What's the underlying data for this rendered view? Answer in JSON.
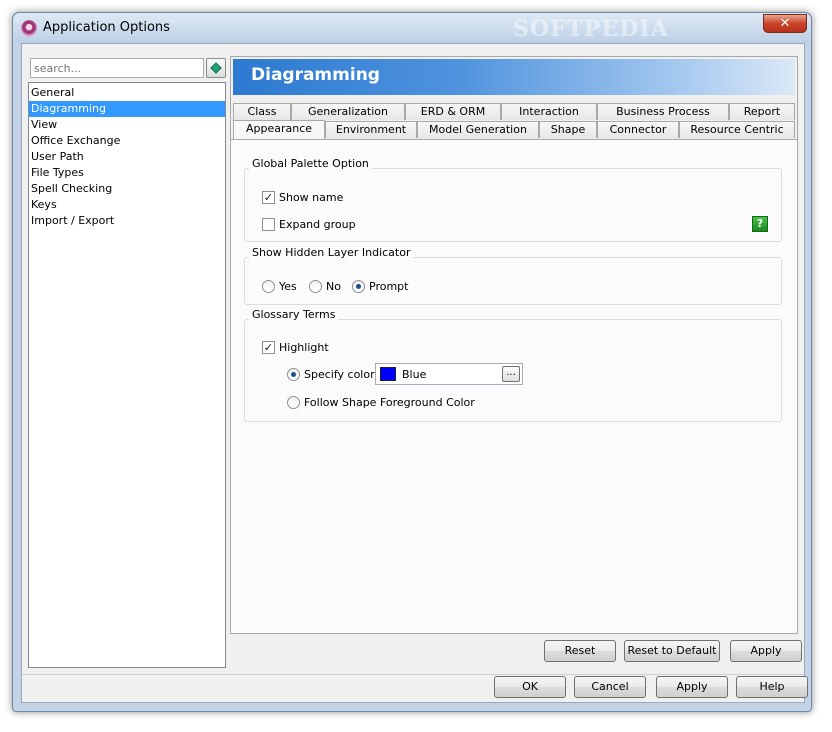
{
  "window": {
    "title": "Application Options",
    "watermark": "SOFTPEDIA",
    "close_glyph": "✕"
  },
  "sidebar": {
    "search_placeholder": "search...",
    "items": [
      {
        "label": "General"
      },
      {
        "label": "Diagramming",
        "selected": true
      },
      {
        "label": "View"
      },
      {
        "label": "Office Exchange"
      },
      {
        "label": "User Path"
      },
      {
        "label": "File Types"
      },
      {
        "label": "Spell Checking"
      },
      {
        "label": "Keys"
      },
      {
        "label": "Import / Export"
      }
    ]
  },
  "header": {
    "title": "Diagramming"
  },
  "tabs": {
    "row1": [
      "Class",
      "Generalization",
      "ERD & ORM",
      "Interaction",
      "Business Process",
      "Report"
    ],
    "row2": [
      "Appearance",
      "Environment",
      "Model Generation",
      "Shape",
      "Connector",
      "Resource Centric"
    ],
    "active": "Appearance"
  },
  "global_palette": {
    "title": "Global Palette Option",
    "show_name": {
      "label": "Show name",
      "checked": true
    },
    "expand_group": {
      "label": "Expand group",
      "checked": false
    },
    "help_glyph": "?"
  },
  "hidden_layer": {
    "title": "Show Hidden Layer Indicator",
    "options": [
      {
        "label": "Yes",
        "selected": false
      },
      {
        "label": "No",
        "selected": false
      },
      {
        "label": "Prompt",
        "selected": true
      }
    ]
  },
  "glossary": {
    "title": "Glossary Terms",
    "highlight": {
      "label": "Highlight",
      "checked": true
    },
    "specify_color": {
      "label": "Specify color",
      "selected": true
    },
    "color_value": "Blue",
    "color_hex": "#0000ff",
    "browse_label": "...",
    "follow_shape": {
      "label": "Follow Shape Foreground Color",
      "selected": false
    }
  },
  "panel_buttons": {
    "reset": "Reset",
    "reset_default": "Reset to Default",
    "apply": "Apply"
  },
  "dialog_buttons": {
    "ok": "OK",
    "cancel": "Cancel",
    "apply": "Apply",
    "help": "Help"
  },
  "icons": {
    "app": "app-logo-icon",
    "search_go": "diamond-search-icon",
    "help": "help-question-icon",
    "close": "close-icon"
  }
}
